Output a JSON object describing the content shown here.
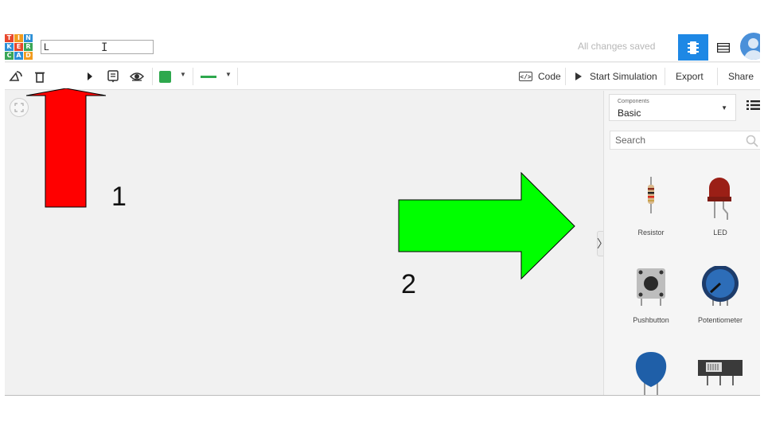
{
  "logo": {
    "letters": [
      "T",
      "I",
      "N",
      "K",
      "E",
      "R",
      "C",
      "A",
      "D"
    ]
  },
  "header": {
    "title_value": "L",
    "save_status": "All changes saved"
  },
  "toolbar": {
    "code_label": "Code",
    "code_icon_glyph": "</>",
    "start_simulation_label": "Start Simulation",
    "export_label": "Export",
    "share_label": "Share",
    "wire_color": "#2ea84d"
  },
  "panel": {
    "components_label": "Components",
    "components_value": "Basic",
    "search_placeholder": "Search",
    "collapse_glyph": "〉",
    "items": [
      {
        "label": "Resistor",
        "icon": "resistor-icon"
      },
      {
        "label": "LED",
        "icon": "led-icon"
      },
      {
        "label": "Pushbutton",
        "icon": "pushbutton-icon"
      },
      {
        "label": "Potentiometer",
        "icon": "potentiometer-icon"
      },
      {
        "label": "",
        "icon": "capacitor-icon"
      },
      {
        "label": "",
        "icon": "slideswitch-icon"
      }
    ]
  },
  "annotations": {
    "arrow1_number": "1",
    "arrow2_number": "2",
    "arrow1_color": "#ff0000",
    "arrow2_color": "#00ff00"
  }
}
